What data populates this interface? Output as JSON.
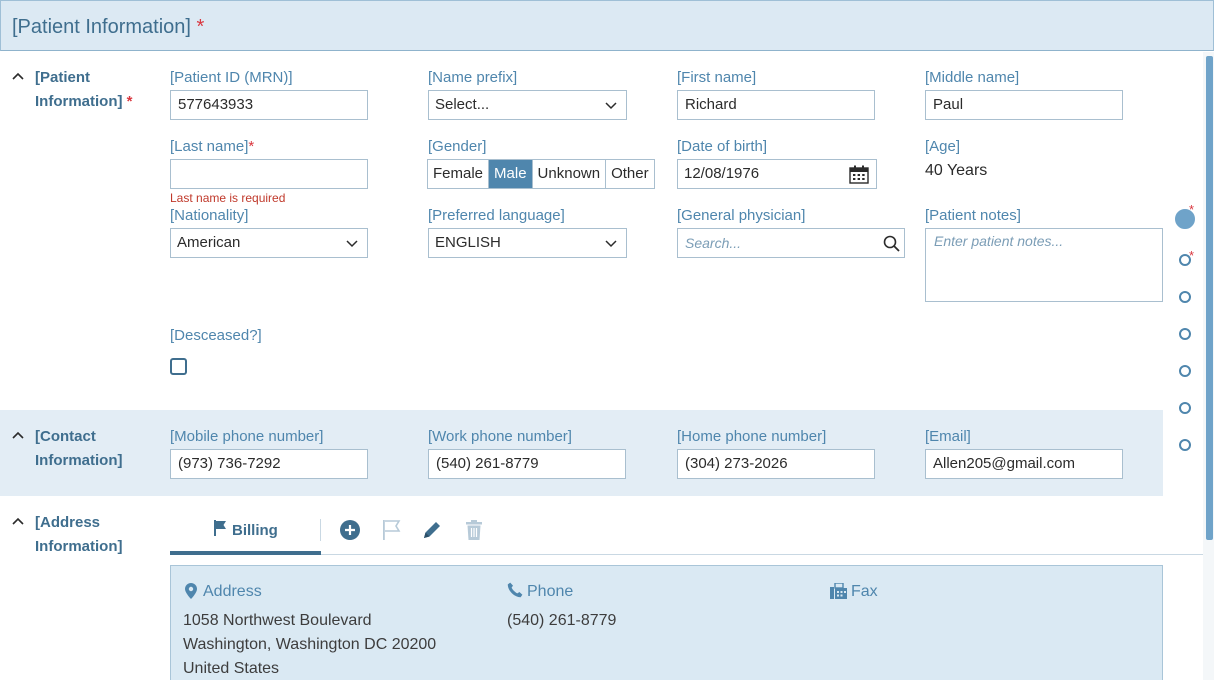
{
  "header": {
    "title": "[Patient Information]",
    "required_mark": "*"
  },
  "sections": {
    "patient": {
      "label_line1": "[Patient",
      "label_line2": "Information]",
      "required_mark": "*"
    },
    "contact": {
      "label_line1": "[Contact",
      "label_line2": "Information]"
    },
    "address": {
      "label_line1": "[Address",
      "label_line2": "Information]"
    }
  },
  "patient_fields": {
    "mrn": {
      "label": "[Patient ID (MRN)]",
      "value": "577643933"
    },
    "name_prefix": {
      "label": "[Name prefix]",
      "value": "Select..."
    },
    "first_name": {
      "label": "[First name]",
      "value": "Richard"
    },
    "middle_name": {
      "label": "[Middle name]",
      "value": "Paul"
    },
    "last_name": {
      "label": "[Last name]",
      "required_mark": "*",
      "value": "",
      "error": "Last name is required"
    },
    "gender": {
      "label": "[Gender]",
      "options": [
        "Female",
        "Male",
        "Unknown",
        "Other"
      ],
      "selected": "Male"
    },
    "dob": {
      "label": "[Date of birth]",
      "value": "12/08/1976"
    },
    "age": {
      "label": "[Age]",
      "value": "40 Years"
    },
    "nationality": {
      "label": "[Nationality]",
      "value": "American"
    },
    "language": {
      "label": "[Preferred language]",
      "value": "ENGLISH"
    },
    "physician": {
      "label": "[General physician]",
      "placeholder": "Search..."
    },
    "notes": {
      "label": "[Patient notes]",
      "placeholder": "Enter patient notes..."
    },
    "deceased": {
      "label": "[Desceased?]",
      "checked": false
    }
  },
  "contact_fields": {
    "mobile": {
      "label": "[Mobile phone number]",
      "value": "(973) 736-7292"
    },
    "work": {
      "label": "[Work phone number]",
      "value": "(540) 261-8779"
    },
    "home": {
      "label": "[Home phone number]",
      "value": "(304) 273-2026"
    },
    "email": {
      "label": "[Email]",
      "value": "Allen205@gmail.com"
    }
  },
  "address_tabs": {
    "active_tab": "Billing"
  },
  "address_card": {
    "address_heading": "Address",
    "address_line1": "1058 Northwest Boulevard",
    "address_line2": "Washington, Washington DC 20200",
    "address_line3": "United States",
    "phone_heading": "Phone",
    "phone_value": "(540) 261-8779",
    "fax_heading": "Fax"
  },
  "side_nav": {
    "required_mark": "*"
  },
  "colors": {
    "accent": "#4f86ad",
    "accent_dark": "#3f6e8e",
    "header_bg": "#dce9f3",
    "required": "#d9363e",
    "error": "#c0392b"
  },
  "icons": [
    "chevron-up-icon",
    "chevron-down-icon",
    "calendar-icon",
    "search-icon",
    "flag-icon",
    "add-circle-icon",
    "flag-outline-icon",
    "pencil-icon",
    "trash-icon",
    "map-marker-icon",
    "phone-icon",
    "fax-icon"
  ]
}
